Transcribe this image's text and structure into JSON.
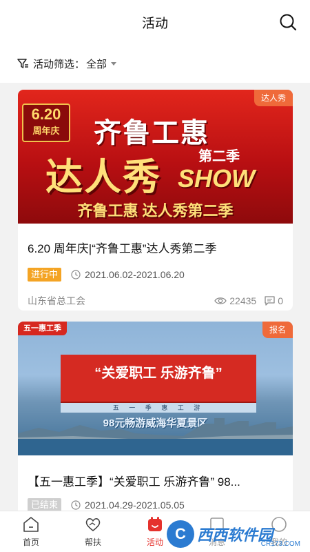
{
  "header": {
    "title": "活动"
  },
  "filter": {
    "label": "活动筛选：",
    "value": "全部"
  },
  "cards": [
    {
      "tag": "达人秀",
      "banner": {
        "badge_number": "6.20",
        "badge_text": "周年庆",
        "line1": "齐鲁工惠",
        "line2": "达人秀",
        "show": "SHOW",
        "season": "第二季",
        "subtitle": "齐鲁工惠 达人秀第二季"
      },
      "title": "6.20 周年庆|“齐鲁工惠”达人秀第二季",
      "status": "进行中",
      "date_range": "2021.06.02-2021.06.20",
      "organizer": "山东省总工会",
      "views": "22435",
      "comments": "0"
    },
    {
      "tag": "报名",
      "banner": {
        "corner": "五一惠工季",
        "headline": "“关爱职工  乐游齐鲁”",
        "strip": "五 一 季 惠 工 游",
        "caption": "98元畅游威海华夏景区"
      },
      "title": "【五一惠工季】“关爱职工 乐游齐鲁” 98...",
      "status": "已结束",
      "date_range": "2021.04.29-2021.05.05"
    }
  ],
  "tabbar": {
    "items": [
      {
        "label": "首页",
        "icon": "home-icon"
      },
      {
        "label": "帮扶",
        "icon": "heart-hands-icon"
      },
      {
        "label": "活动",
        "icon": "calendar-icon"
      },
      {
        "label": "消息",
        "icon": "message-icon"
      },
      {
        "label": "我的",
        "icon": "profile-icon"
      }
    ]
  },
  "watermark": {
    "text": "西西软件园",
    "sub": "CR173.COM",
    "logo": "C"
  },
  "colors": {
    "accent": "#e5322d",
    "status_active": "#f4a424",
    "status_ended": "#cfcfcf",
    "tag": "#ef6a3a"
  }
}
